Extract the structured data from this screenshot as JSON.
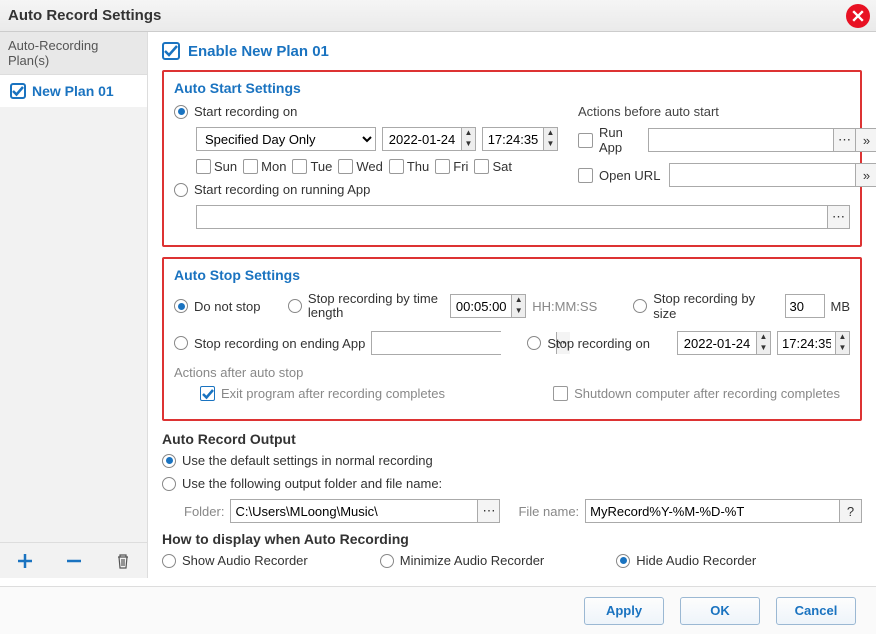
{
  "title": "Auto Record Settings",
  "sidebar": {
    "header": "Auto-Recording Plan(s)",
    "items": [
      {
        "label": "New Plan 01",
        "checked": true
      }
    ]
  },
  "enable": {
    "label": "Enable New Plan 01"
  },
  "startSection": {
    "title": "Auto Start Settings",
    "startOn": {
      "label": "Start recording on",
      "mode": "Specified Day Only",
      "date": "2022-01-24",
      "time": "17:24:35"
    },
    "days": {
      "sun": "Sun",
      "mon": "Mon",
      "tue": "Tue",
      "wed": "Wed",
      "thu": "Thu",
      "fri": "Fri",
      "sat": "Sat"
    },
    "startOnApp": {
      "label": "Start recording on running App",
      "value": ""
    },
    "actionsTitle": "Actions before auto start",
    "runApp": {
      "label": "Run App",
      "value": ""
    },
    "openUrl": {
      "label": "Open URL",
      "value": ""
    }
  },
  "stopSection": {
    "title": "Auto Stop Settings",
    "doNotStop": "Do not stop",
    "byLength": {
      "label": "Stop recording by time length",
      "value": "00:05:00",
      "unit": "HH:MM:SS"
    },
    "bySize": {
      "label": "Stop recording by size",
      "value": "30",
      "unit": "MB"
    },
    "onEndingApp": {
      "label": "Stop recording on ending App",
      "value": ""
    },
    "onTime": {
      "label": "Stop recording on",
      "date": "2022-01-24",
      "time": "17:24:35"
    },
    "afterTitle": "Actions after auto stop",
    "exitProgram": "Exit program after recording completes",
    "shutdown": "Shutdown computer after recording completes"
  },
  "output": {
    "title": "Auto Record Output",
    "useDefault": "Use the default settings in normal recording",
    "useCustom": "Use the following output folder and file name:",
    "folderLabel": "Folder:",
    "folder": "C:\\Users\\MLoong\\Music\\",
    "fileLabel": "File name:",
    "file": "MyRecord%Y-%M-%D-%T"
  },
  "display": {
    "title": "How to display when Auto Recording",
    "show": "Show Audio Recorder",
    "minimize": "Minimize Audio Recorder",
    "hide": "Hide Audio Recorder"
  },
  "buttons": {
    "apply": "Apply",
    "ok": "OK",
    "cancel": "Cancel"
  }
}
